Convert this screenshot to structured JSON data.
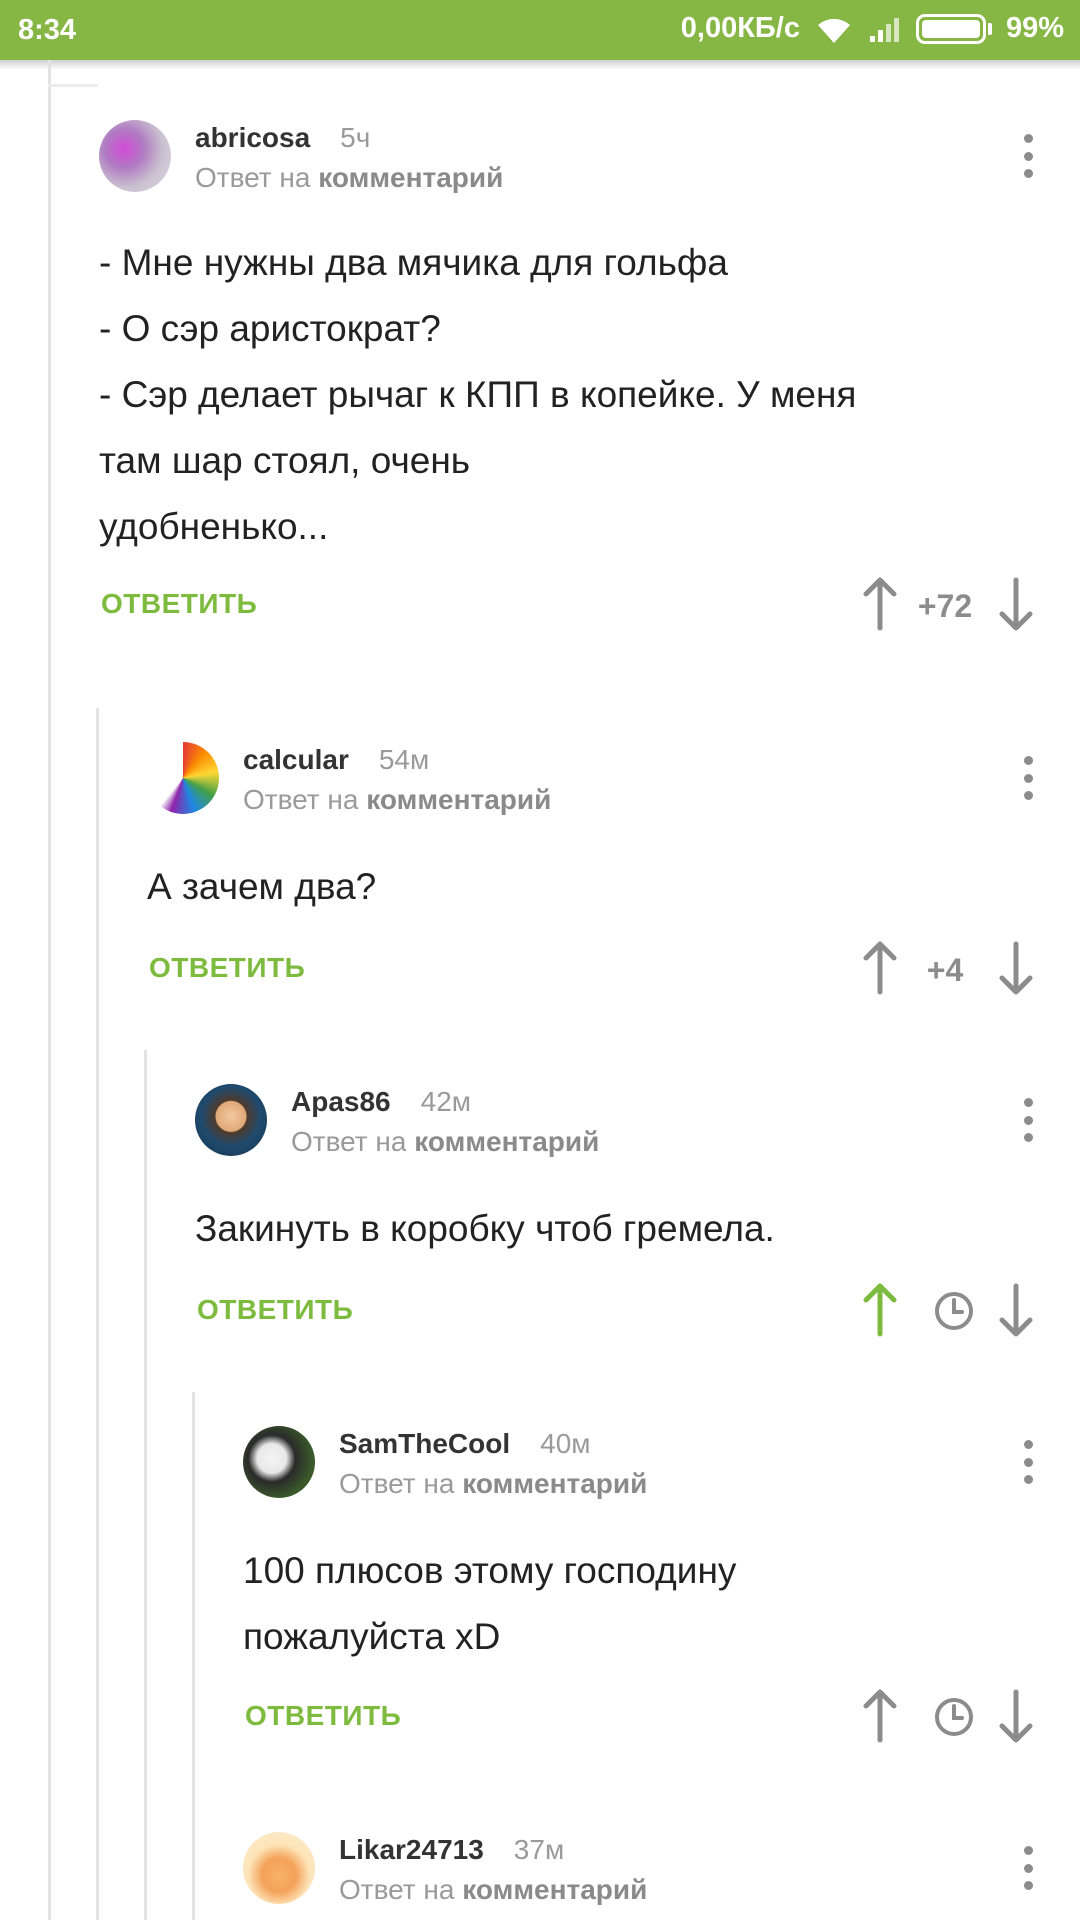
{
  "status_bar": {
    "time": "8:34",
    "speed": "0,00КБ/с",
    "battery": "99%",
    "background": "#86b644"
  },
  "comments": [
    {
      "user": "abricosa",
      "time": "5ч",
      "reply_prefix": "Ответ на",
      "reply_link": "комментарий",
      "body": [
        "- Мне нужны два мячика для гольфа",
        "- О сэр аристократ?",
        "- Сэр делает рычаг к КПП в копейке. У меня",
        "там шар стоял, очень",
        "удобненько..."
      ],
      "reply_label": "ОТВЕТИТЬ",
      "rating": "+72",
      "upvoted": false
    },
    {
      "user": "calcular",
      "time": "54м",
      "reply_prefix": "Ответ на",
      "reply_link": "комментарий",
      "body": [
        "А зачем два?"
      ],
      "reply_label": "ОТВЕТИТЬ",
      "rating": "+4",
      "upvoted": false
    },
    {
      "user": "Apas86",
      "time": "42м",
      "reply_prefix": "Ответ на",
      "reply_link": "комментарий",
      "body": [
        "Закинуть в коробку чтоб гремела."
      ],
      "reply_label": "ОТВЕТИТЬ",
      "rating_icon": "clock-icon",
      "upvoted": true
    },
    {
      "user": "SamTheCool",
      "time": "40м",
      "reply_prefix": "Ответ на",
      "reply_link": "комментарий",
      "body": [
        "100 плюсов этому господину",
        "пожалуйста xD"
      ],
      "reply_label": "ОТВЕТИТЬ",
      "rating_icon": "clock-icon",
      "upvoted": false
    },
    {
      "user": "Likar24713",
      "time": "37м",
      "reply_prefix": "Ответ на",
      "reply_link": "комментарий"
    }
  ],
  "colors": {
    "accent_green": "#7dbb3e",
    "upvote_active": "#7dbb3e",
    "icon_grey": "#8c8c8c"
  }
}
